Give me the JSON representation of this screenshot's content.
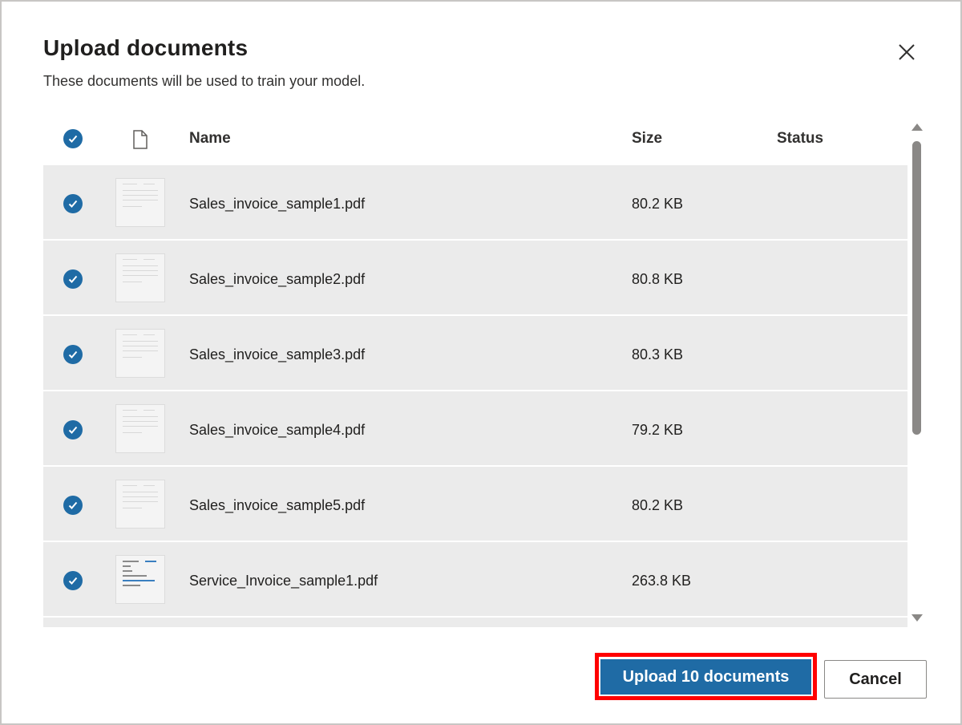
{
  "dialog": {
    "title": "Upload documents",
    "subtitle": "These documents will be used to train your model.",
    "close_icon": "close-icon"
  },
  "table": {
    "headers": {
      "select_all": "check-circle-icon",
      "file_type": "document-icon",
      "name": "Name",
      "size": "Size",
      "status": "Status"
    },
    "rows": [
      {
        "name": "Sales_invoice_sample1.pdf",
        "size": "80.2 KB",
        "status": "",
        "selected": true
      },
      {
        "name": "Sales_invoice_sample2.pdf",
        "size": "80.8 KB",
        "status": "",
        "selected": true
      },
      {
        "name": "Sales_invoice_sample3.pdf",
        "size": "80.3 KB",
        "status": "",
        "selected": true
      },
      {
        "name": "Sales_invoice_sample4.pdf",
        "size": "79.2 KB",
        "status": "",
        "selected": true
      },
      {
        "name": "Sales_invoice_sample5.pdf",
        "size": "80.2 KB",
        "status": "",
        "selected": true
      },
      {
        "name": "Service_Invoice_sample1.pdf",
        "size": "263.8 KB",
        "status": "",
        "selected": true
      }
    ]
  },
  "footer": {
    "upload_label": "Upload 10 documents",
    "cancel_label": "Cancel"
  },
  "colors": {
    "accent": "#1f6ba5",
    "highlight": "#ff0000",
    "row_background": "#ebebeb"
  }
}
